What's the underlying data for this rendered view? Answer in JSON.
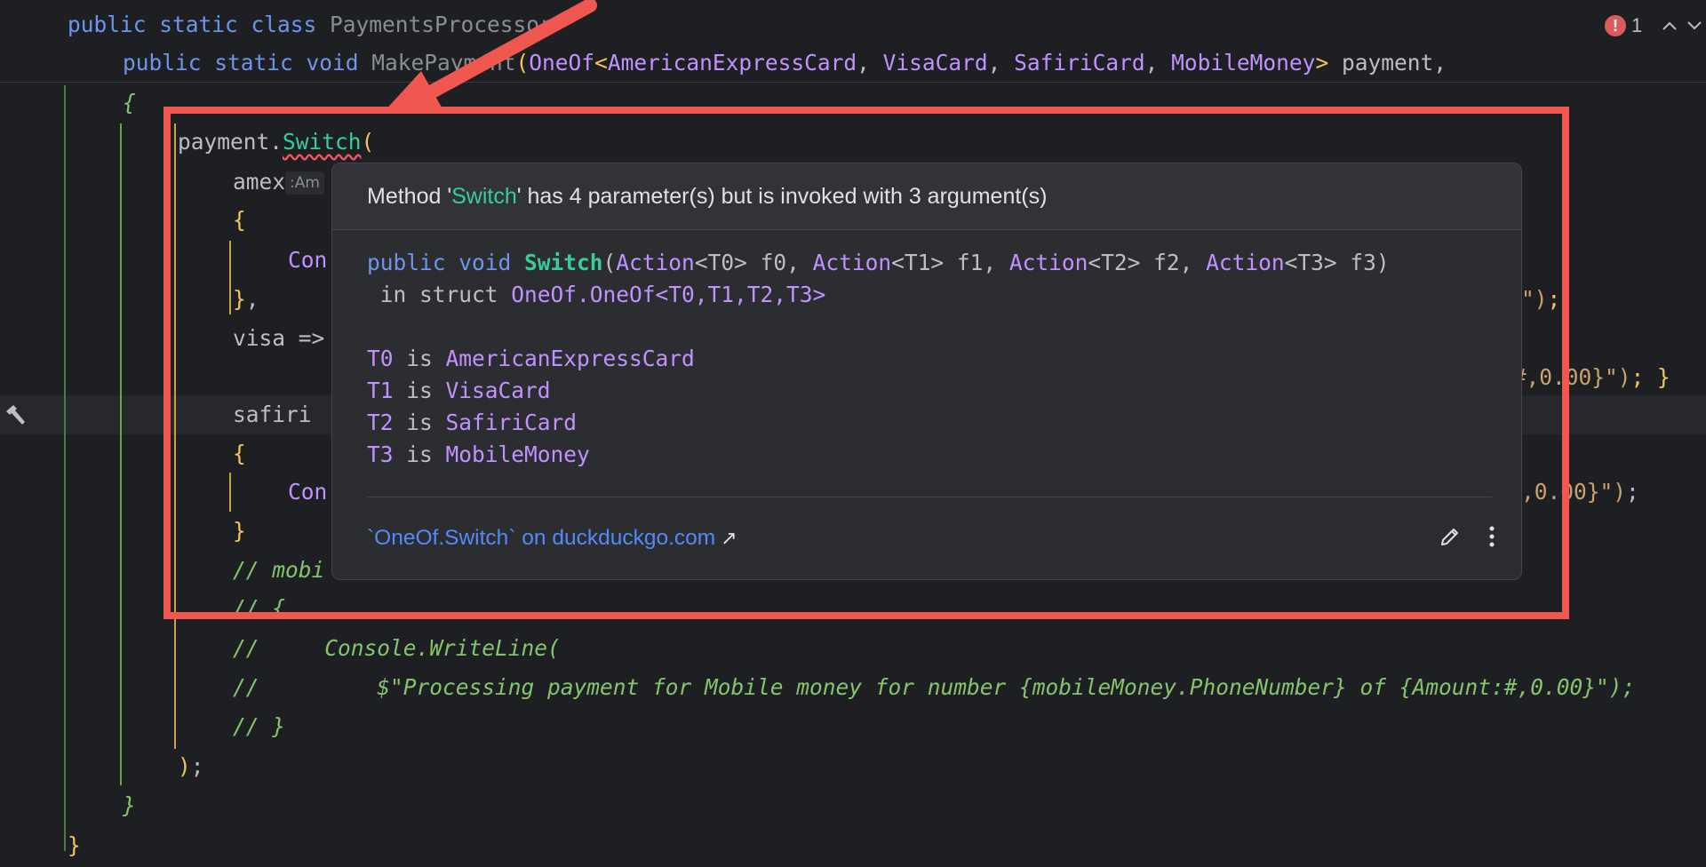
{
  "editor": {
    "lines": [
      {
        "parts": [
          {
            "t": "public static class ",
            "c": "kw"
          },
          {
            "t": "PaymentsProcessor",
            "c": "gr"
          }
        ]
      },
      {
        "parts": [
          {
            "t": "public static void ",
            "c": "kw"
          },
          {
            "t": "MakePayment",
            "c": "gr"
          },
          {
            "t": "(",
            "c": "br"
          },
          {
            "t": "OneOf",
            "c": "ty"
          },
          {
            "t": "<",
            "c": "br"
          },
          {
            "t": "AmericanExpressCard",
            "c": "ty"
          },
          {
            "t": ", "
          },
          {
            "t": "VisaCard",
            "c": "ty"
          },
          {
            "t": ", "
          },
          {
            "t": "SafiriCard",
            "c": "ty"
          },
          {
            "t": ", "
          },
          {
            "t": "MobileMoney",
            "c": "ty"
          },
          {
            "t": ">",
            "c": "br"
          },
          {
            "t": " payment,"
          }
        ]
      },
      {
        "parts": [
          {
            "t": "{",
            "c": "cm"
          }
        ]
      },
      {
        "parts": [
          {
            "t": "payment."
          },
          {
            "t": "Switch",
            "c": "mt sq"
          },
          {
            "t": "(",
            "c": "br"
          }
        ]
      },
      {
        "parts": [
          {
            "t": "amex"
          },
          {
            "t": ":Am",
            "c": "hint"
          }
        ]
      },
      {
        "parts": [
          {
            "t": "{",
            "c": "br"
          }
        ]
      },
      {
        "parts": [
          {
            "t": "Con",
            "c": "ty"
          }
        ]
      },
      {
        "parts": [
          {
            "t": "}",
            "c": "br"
          },
          {
            "t": ","
          }
        ]
      },
      {
        "parts": [
          {
            "t": "visa =>"
          }
        ]
      },
      {
        "parts": [
          {
            "t": "safiri"
          }
        ]
      },
      {
        "parts": [
          {
            "t": "{",
            "c": "br"
          }
        ]
      },
      {
        "parts": [
          {
            "t": "Con",
            "c": "ty"
          }
        ]
      },
      {
        "parts": [
          {
            "t": "}",
            "c": "br"
          }
        ]
      },
      {
        "parts": [
          {
            "t": "// mobi",
            "c": "cm"
          }
        ]
      },
      {
        "parts": [
          {
            "t": "// {",
            "c": "cm"
          }
        ]
      },
      {
        "parts": [
          {
            "t": "//     Console.WriteLine(",
            "c": "cm"
          }
        ]
      },
      {
        "parts": [
          {
            "t": "//         $\"Processing payment for Mobile money for number {mobileMoney.PhoneNumber} of {Amount:#,0.00}\");",
            "c": "cm"
          }
        ]
      },
      {
        "parts": [
          {
            "t": "// }",
            "c": "cm"
          }
        ]
      },
      {
        "parts": [
          {
            "t": ")",
            "c": "br"
          },
          {
            "t": ";"
          }
        ]
      },
      {
        "parts": [
          {
            "t": "}",
            "c": "cm"
          }
        ]
      },
      {
        "parts": [
          {
            "t": "}",
            "c": "br"
          }
        ]
      }
    ],
    "right_fragments": [
      {
        "parts": [
          {
            "t": "\")",
            "c": "st"
          },
          {
            "t": ";",
            "c": "br"
          }
        ]
      },
      {
        "parts": [
          {
            "t": ":#,0.00}\")",
            "c": "st"
          },
          {
            "t": "; }",
            "c": "br"
          }
        ]
      },
      {
        "parts": [
          {
            "t": ",0.00}\")",
            "c": "st"
          },
          {
            "t": ";"
          }
        ]
      }
    ]
  },
  "status": {
    "error_count": "1",
    "error_glyph": "!",
    "up_icon": "chevron-up-icon",
    "down_icon": "chevron-down-icon"
  },
  "gutter": {
    "icon": "hammer-icon"
  },
  "tooltip": {
    "header": {
      "prefix": "Method '",
      "method": "Switch",
      "suffix": "' has 4 parameter(s) but is invoked with 3 argument(s)"
    },
    "signature_lines": [
      {
        "parts": [
          {
            "t": "public void ",
            "c": "kw"
          },
          {
            "t": "Switch",
            "c": "mt",
            "b": true
          },
          {
            "t": "("
          },
          {
            "t": "Action",
            "c": "ty"
          },
          {
            "t": "<T0> f0, "
          },
          {
            "t": "Action",
            "c": "ty"
          },
          {
            "t": "<T1> f1, "
          },
          {
            "t": "Action",
            "c": "ty"
          },
          {
            "t": "<T2> f2, "
          },
          {
            "t": "Action",
            "c": "ty"
          },
          {
            "t": "<T3> f3)"
          }
        ]
      },
      {
        "parts": [
          {
            "t": " in struct "
          },
          {
            "t": "OneOf.OneOf<T0,T1,T2,T3>",
            "c": "ty"
          }
        ]
      },
      {
        "parts": [
          {
            "t": ""
          }
        ]
      },
      {
        "parts": [
          {
            "t": "T0",
            "c": "ty"
          },
          {
            "t": " is "
          },
          {
            "t": "AmericanExpressCard",
            "c": "ty"
          }
        ]
      },
      {
        "parts": [
          {
            "t": "T1",
            "c": "ty"
          },
          {
            "t": " is "
          },
          {
            "t": "VisaCard",
            "c": "ty"
          }
        ]
      },
      {
        "parts": [
          {
            "t": "T2",
            "c": "ty"
          },
          {
            "t": " is "
          },
          {
            "t": "SafiriCard",
            "c": "ty"
          }
        ]
      },
      {
        "parts": [
          {
            "t": "T3",
            "c": "ty"
          },
          {
            "t": " is "
          },
          {
            "t": "MobileMoney",
            "c": "ty"
          }
        ]
      }
    ],
    "link_text": "`OneOf.Switch` on duckduckgo.com",
    "link_arrow": "↗",
    "edit_icon": "pencil-icon",
    "more_icon": "more-vertical-icon"
  },
  "colors": {
    "annotation": "#f0574f",
    "error": "#db5c5c",
    "link": "#548af7"
  }
}
